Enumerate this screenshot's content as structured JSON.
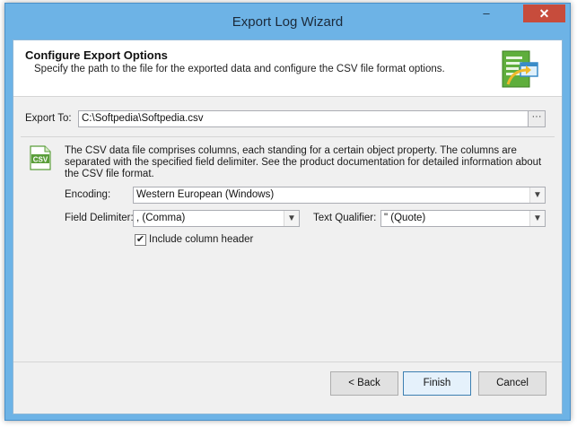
{
  "window": {
    "title": "Export Log Wizard",
    "controls": {
      "minimize": "‒",
      "close": "✕"
    }
  },
  "header": {
    "title": "Configure Export Options",
    "subtitle": "Specify the path to the file for the exported data and configure the CSV file format options."
  },
  "export": {
    "label": "Export To:",
    "value": "C:\\Softpedia\\Softpedia.csv",
    "browse_label": "···"
  },
  "csv": {
    "icon_text": "CSV",
    "description": "The CSV data file comprises columns, each standing for a certain object property. The columns are separated with the specified field delimiter. See the product documentation for detailed information about the CSV file format.",
    "encoding_label": "Encoding:",
    "encoding_value": "Western European (Windows)",
    "delimiter_label": "Field Delimiter:",
    "delimiter_value": ", (Comma)",
    "qualifier_label": "Text Qualifier:",
    "qualifier_value": "\" (Quote)",
    "include_header_label": "Include column header",
    "include_header_checked": true
  },
  "buttons": {
    "back": "< Back",
    "finish": "Finish",
    "cancel": "Cancel"
  },
  "colors": {
    "title_bar": "#6db3e6",
    "close_button": "#c74c3c",
    "csv_icon": "#5a9e3a"
  }
}
